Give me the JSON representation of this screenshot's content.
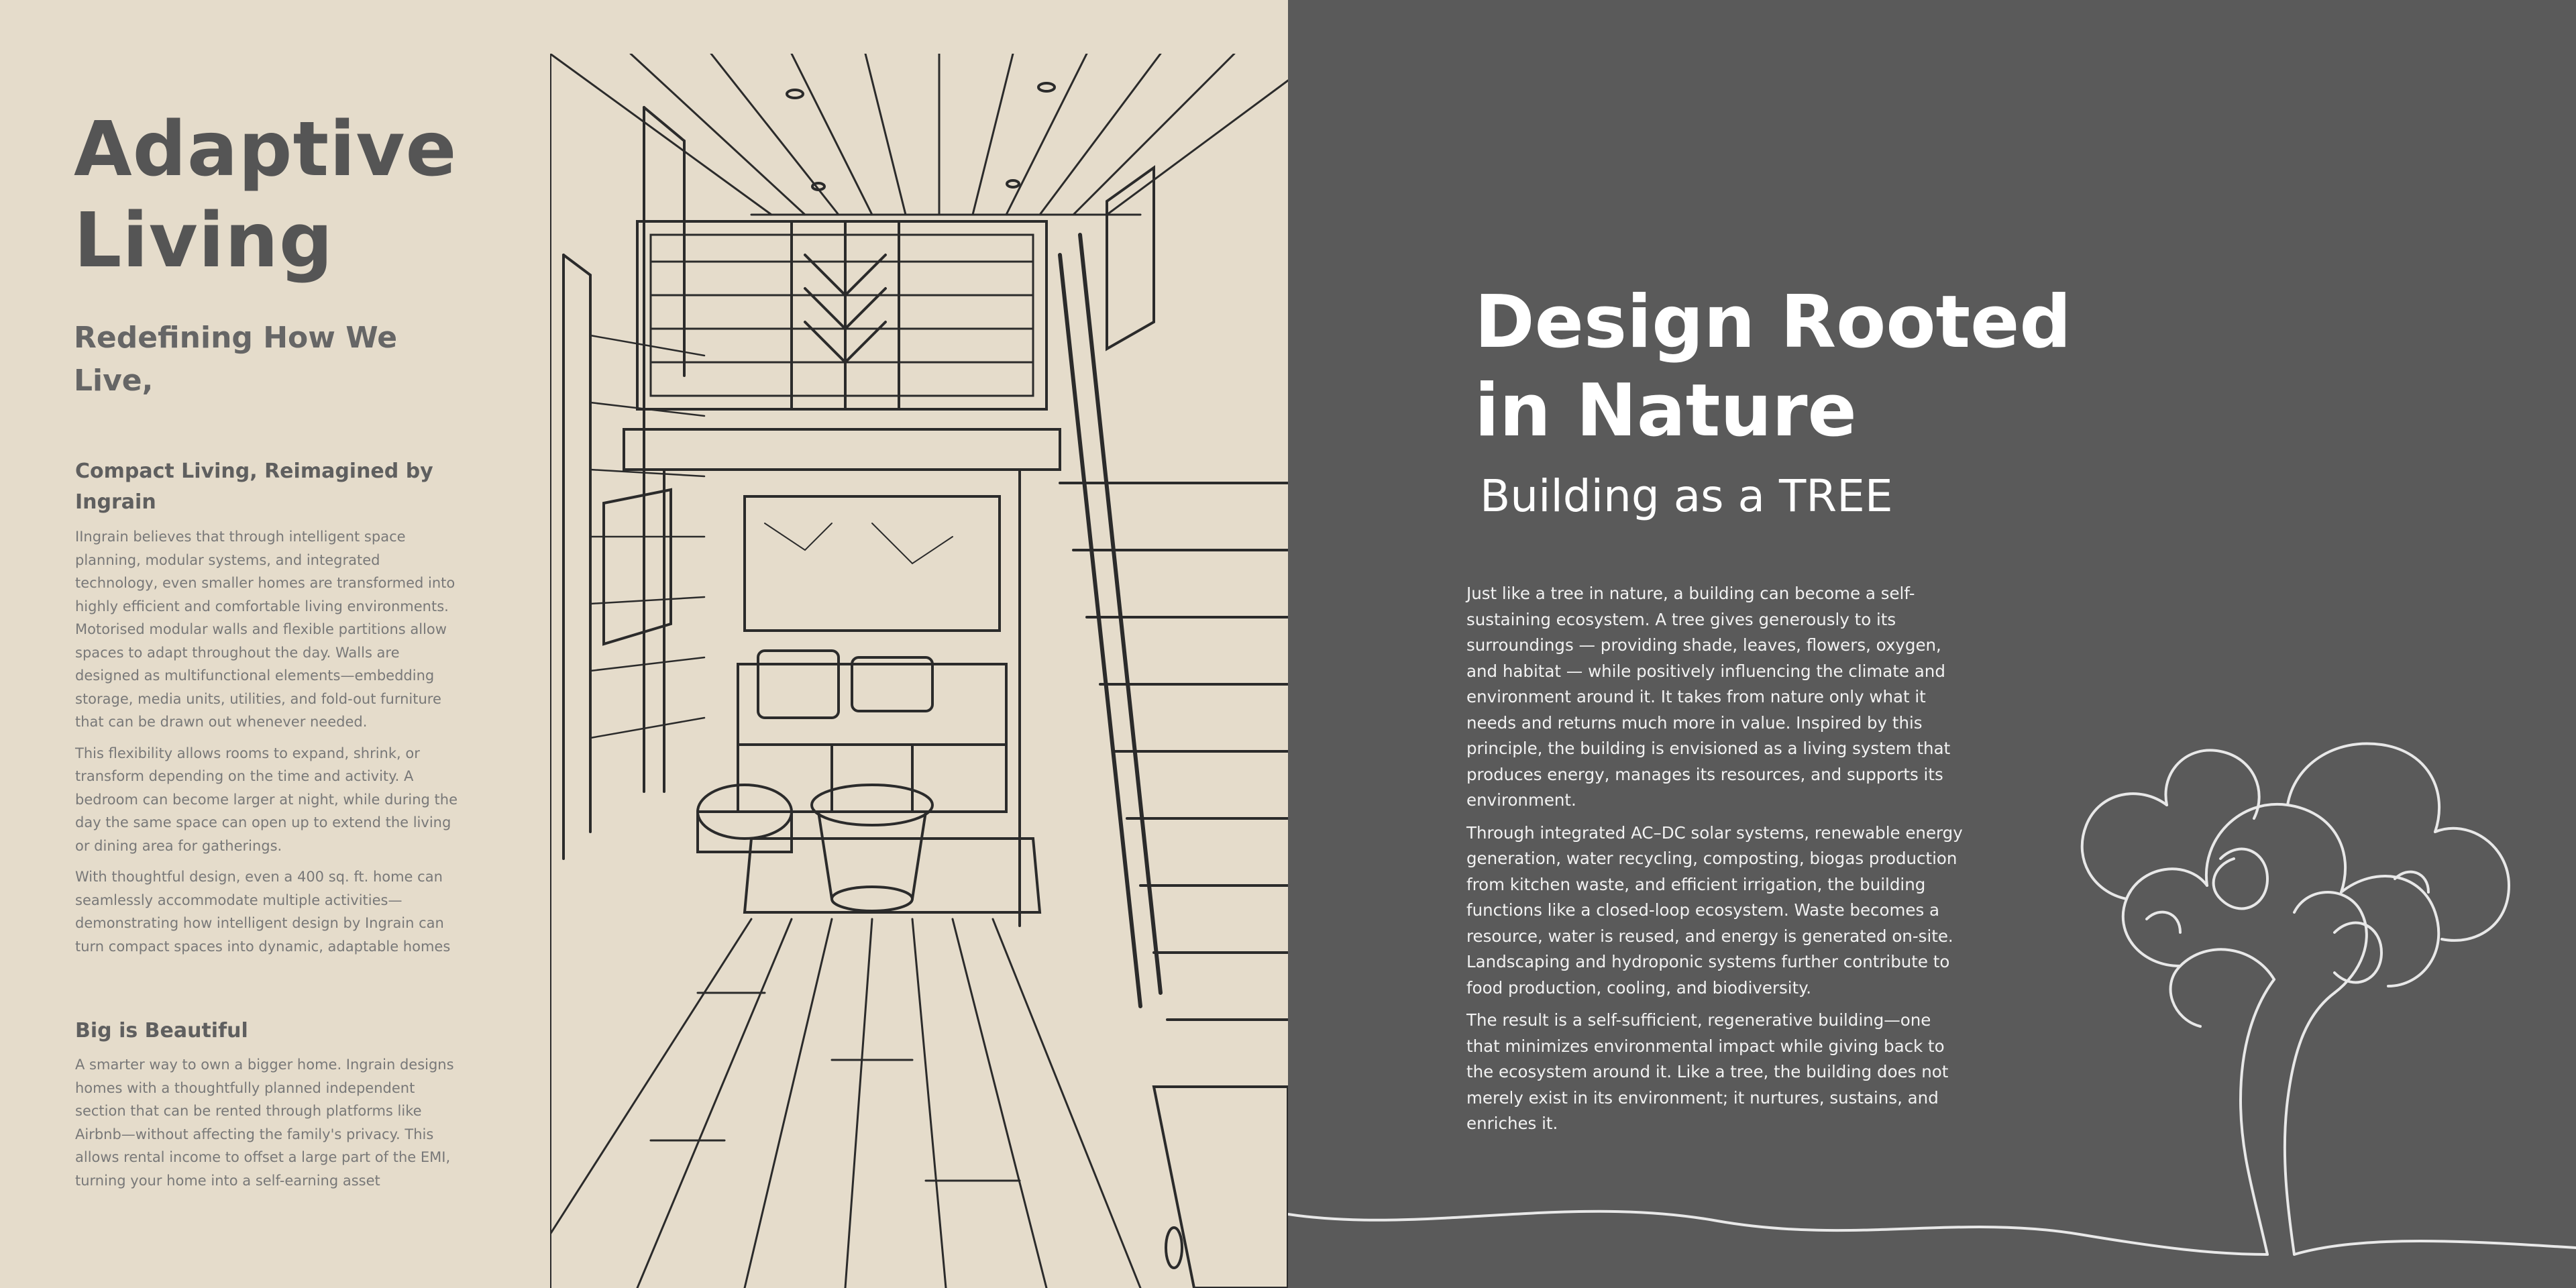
{
  "left": {
    "title_line1": "Adaptive",
    "title_line2": "Living",
    "subtitle_line1": "Redefining How We",
    "subtitle_line2": "Live,",
    "section1": {
      "heading": "Compact Living, Reimagined by Ingrain",
      "paragraphs": [
        "IIngrain believes that through intelligent space planning, modular systems, and integrated technology, even smaller homes are transformed into highly efficient and comfortable living environments. Motorised modular walls and flexible partitions allow spaces to adapt throughout the day. Walls are designed as multifunctional elements—embedding storage, media units, utilities, and fold-out furniture that can be drawn out whenever needed.",
        "This flexibility allows rooms to expand, shrink, or transform depending on the time and activity. A bedroom can become larger at night, while during the day the same space can open up to extend the living or dining area for gatherings.",
        "With thoughtful design, even a 400 sq. ft. home can seamlessly accommodate multiple activities—demonstrating how intelligent design by Ingrain can turn compact spaces into dynamic, adaptable homes"
      ]
    },
    "section2": {
      "heading": "Big is Beautiful",
      "paragraph": "A smarter way to own a bigger home. Ingrain designs homes with a thoughtfully planned independent section that can be rented through platforms like Airbnb—without affecting the family's privacy. This allows rental income to offset a large part of the EMI, turning your home into a self-earning asset"
    }
  },
  "right": {
    "title_line1": "Design Rooted",
    "title_line2": "in Nature",
    "subtitle": "Building as a TREE",
    "paragraphs": [
      "Just like a tree in nature, a building can become a self-sustaining ecosystem. A tree gives generously to its surroundings — providing shade, leaves, flowers, oxygen, and habitat — while positively influencing the climate and environment around it. It takes from nature only what it needs and returns much more in value. Inspired by this principle, the building is envisioned as a living system that produces energy, manages its resources, and supports its environment.",
      "Through integrated AC–DC solar systems, renewable energy generation, water recycling, composting, biogas production from kitchen waste, and efficient irrigation, the building functions like a closed-loop ecosystem. Waste becomes a resource, water is reused, and energy is generated on-site. Landscaping and hydroponic systems further contribute to food production, cooling, and biodiversity.",
      "The result is a self-sufficient, regenerative building—one that minimizes environmental impact while giving back to the ecosystem around it. Like a tree, the building does not merely exist in its environment; it nurtures, sustains, and enriches it."
    ]
  },
  "colors": {
    "left_background": "#e5dccb",
    "right_background": "#5a5a5a",
    "heading_gray": "#555555",
    "body_gray": "#787878",
    "line_art": "#2b2b2b",
    "tree_line": "#e8e8e8"
  },
  "icons": {
    "illustration": "tiny-house-interior-sketch",
    "tree": "tree-line-drawing"
  }
}
